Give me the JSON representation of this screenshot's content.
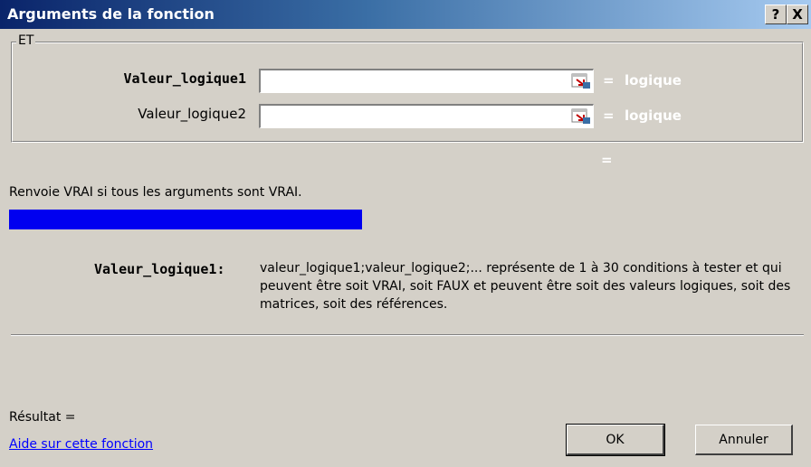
{
  "window": {
    "title": "Arguments de la fonction",
    "help_glyph": "?",
    "close_glyph": "X"
  },
  "function_group": {
    "legend": "ET",
    "args": [
      {
        "label": "Valeur_logique1",
        "value": "",
        "eq": "=",
        "result": "logique"
      },
      {
        "label": "Valeur_logique2",
        "value": "",
        "eq": "=",
        "result": "logique"
      }
    ]
  },
  "formula_result_eq": "=",
  "description": "Renvoie VRAI si tous les arguments sont VRAI.",
  "arg_help": {
    "label": "Valeur_logique1:",
    "text": "valeur_logique1;valeur_logique2;... représente de 1 à 30 conditions à tester et qui peuvent être soit VRAI, soit FAUX et peuvent être soit des valeurs logiques, soit des matrices, soit des références."
  },
  "result_label": "Résultat =",
  "help_link": "Aide sur cette fonction",
  "buttons": {
    "ok": "OK",
    "cancel": "Annuler"
  },
  "colors": {
    "accent_bar": "#0000f0",
    "title_start": "#0a246a",
    "link": "#0000ff"
  }
}
